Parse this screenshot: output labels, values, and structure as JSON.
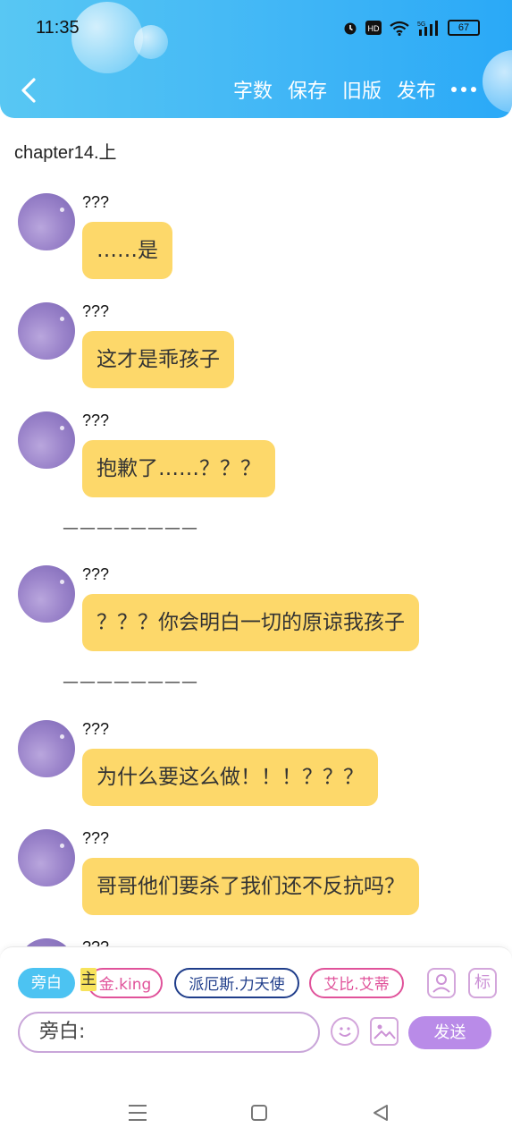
{
  "status_bar": {
    "time": "11:35",
    "battery": "67"
  },
  "toolbar": {
    "word_count": "字数",
    "save": "保存",
    "old_version": "旧版",
    "publish": "发布"
  },
  "chapter_title": "chapter14.上",
  "messages": [
    {
      "name": "???",
      "text": "……是"
    },
    {
      "name": "???",
      "text": "这才是乖孩子"
    },
    {
      "name": "???",
      "text": "抱歉了……？？？"
    },
    {
      "name": "???",
      "text": "？？？你会明白一切的原谅我孩子"
    },
    {
      "name": "???",
      "text": "为什么要这么做！！！？？？"
    },
    {
      "name": "???",
      "text": "哥哥他们要杀了我们还不反抗吗？"
    },
    {
      "name": "???"
    }
  ],
  "dividers": [
    "————————",
    "————————"
  ],
  "characters": {
    "narration": "旁白",
    "main": "主",
    "jin": "金.king",
    "pani": "派厄斯.力天使",
    "abi": "艾比.艾蒂"
  },
  "tool_mark": "标",
  "composer": {
    "prefix": "旁白:",
    "send": "发送"
  },
  "colors": {
    "header": "#3fb5f6",
    "bubble": "#fdd86a",
    "send": "#b98be8",
    "narration_chip": "#4cc3f2"
  }
}
